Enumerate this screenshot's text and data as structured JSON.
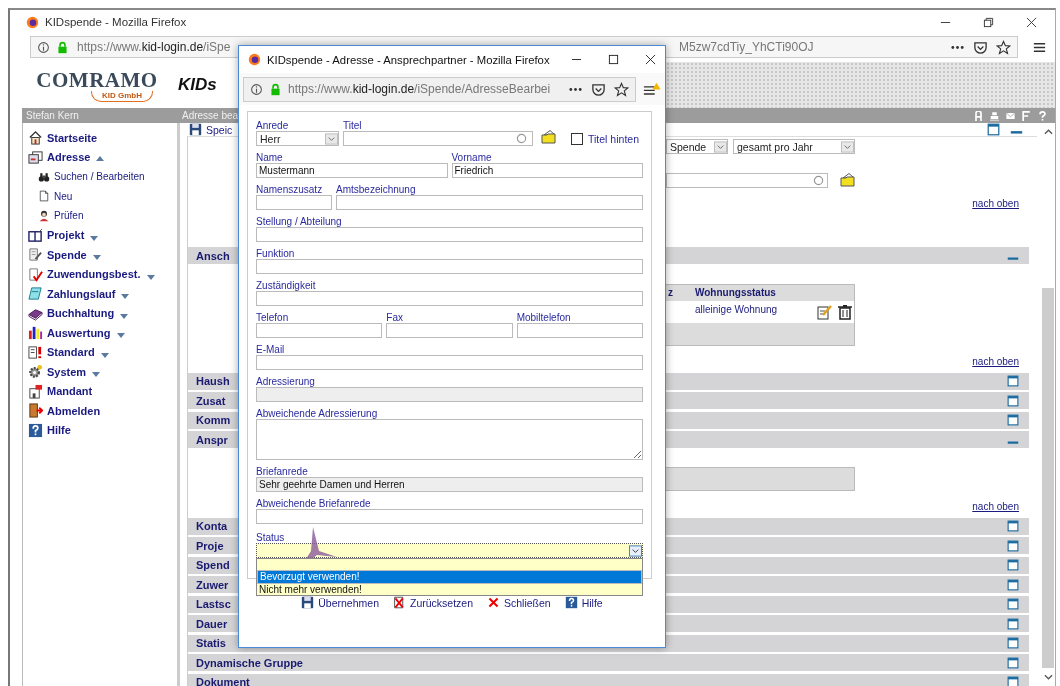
{
  "window": {
    "title": "KIDspende - Mozilla Firefox",
    "url": {
      "scheme": "https://www.",
      "domain": "kid-login.de",
      "path": "/iSpe"
    },
    "url_end": "M5zw7cdTiy_YhCTi90OJ"
  },
  "header": {
    "logo": "COMRAMO",
    "logo_badge": "KID GmbH",
    "brand": "KIDs"
  },
  "user_bar": {
    "user": "Stefan Kern",
    "page_title": "Adresse bea"
  },
  "sidebar": {
    "items": [
      {
        "label": "Startseite",
        "kind": "link"
      },
      {
        "label": "Adresse",
        "kind": "group",
        "expanded": true,
        "children": [
          {
            "label": "Suchen / Bearbeiten"
          },
          {
            "label": "Neu"
          },
          {
            "label": "Prüfen"
          }
        ]
      },
      {
        "label": "Projekt",
        "kind": "group",
        "expanded": false
      },
      {
        "label": "Spende",
        "kind": "group",
        "expanded": false
      },
      {
        "label": "Zuwendungsbest.",
        "kind": "group",
        "expanded": false
      },
      {
        "label": "Zahlungslauf",
        "kind": "group",
        "expanded": false
      },
      {
        "label": "Buchhaltung",
        "kind": "group",
        "expanded": false
      },
      {
        "label": "Auswertung",
        "kind": "group",
        "expanded": false
      },
      {
        "label": "Standard",
        "kind": "group",
        "expanded": false
      },
      {
        "label": "System",
        "kind": "group",
        "expanded": false
      },
      {
        "label": "Mandant",
        "kind": "link"
      },
      {
        "label": "Abmelden",
        "kind": "link"
      },
      {
        "label": "Hilfe",
        "kind": "link"
      }
    ]
  },
  "content": {
    "toolbar_button": "Speic",
    "filters": [
      "Spende",
      "gesamt pro Jahr"
    ],
    "top_link": "nach oben",
    "sections": [
      {
        "title": "Ansch",
        "expanded": true,
        "table": {
          "columns": [
            "z",
            "Wohnungsstatus"
          ],
          "rows": [
            {
              "wohnungsstatus": "alleinige Wohnung"
            }
          ]
        },
        "link": "nach oben"
      },
      {
        "title": "Haush",
        "expanded": false
      },
      {
        "title": "Zusat",
        "expanded": false
      },
      {
        "title": "Komm",
        "expanded": false
      },
      {
        "title": "Anspr",
        "expanded": true,
        "link": "nach oben"
      },
      {
        "title": "Konta",
        "expanded": false
      },
      {
        "title": "Proje",
        "expanded": false
      },
      {
        "title": "Spend",
        "expanded": false
      },
      {
        "title": "Zuwer",
        "expanded": false
      },
      {
        "title": "Lastsc",
        "expanded": false
      },
      {
        "title": "Dauer",
        "expanded": false
      },
      {
        "title": "Statis",
        "expanded": false
      },
      {
        "title": "Dynamische Gruppe",
        "expanded": false
      },
      {
        "title": "Dokument",
        "expanded": false
      }
    ]
  },
  "popup": {
    "title": "KIDspende - Adresse - Ansprechpartner - Mozilla Firefox",
    "url": {
      "scheme": "https://www.",
      "domain": "kid-login.de",
      "path": "/iSpende/AdresseBearbei"
    },
    "form": {
      "anrede": {
        "label": "Anrede",
        "value": "Herr"
      },
      "titel": {
        "label": "Titel"
      },
      "titel_hinten": {
        "label": "Titel hinten",
        "checked": false
      },
      "rows": [
        {
          "fields": [
            {
              "label": "Name",
              "kind": "text",
              "value": "Mustermann"
            },
            {
              "label": "Vorname",
              "kind": "text",
              "value": "Friedrich"
            }
          ]
        },
        {
          "fields": [
            {
              "label": "Namenszusatz",
              "kind": "text"
            },
            {
              "label": "Amtsbezeichnung",
              "kind": "text"
            }
          ]
        },
        {
          "fields": [
            {
              "label": "Stellung / Abteilung",
              "kind": "text"
            }
          ]
        },
        {
          "fields": [
            {
              "label": "Funktion",
              "kind": "text"
            }
          ]
        },
        {
          "fields": [
            {
              "label": "Zuständigkeit",
              "kind": "text"
            }
          ]
        },
        {
          "fields": [
            {
              "label": "Telefon",
              "kind": "text"
            },
            {
              "label": "Fax",
              "kind": "text"
            },
            {
              "label": "Mobiltelefon",
              "kind": "text"
            }
          ]
        },
        {
          "fields": [
            {
              "label": "E-Mail",
              "kind": "text"
            }
          ]
        },
        {
          "fields": [
            {
              "label": "Adressierung",
              "kind": "readonly"
            }
          ]
        },
        {
          "fields": [
            {
              "label": "Abweichende Adressierung",
              "kind": "textarea"
            }
          ]
        },
        {
          "fields": [
            {
              "label": "Briefanrede",
              "kind": "readonly",
              "value": "Sehr geehrte Damen und Herren"
            }
          ]
        },
        {
          "fields": [
            {
              "label": "Abweichende Briefanrede",
              "kind": "text"
            }
          ]
        }
      ],
      "status": {
        "label": "Status",
        "open": true,
        "options": [
          {
            "label": "Bevorzugt verwenden!",
            "selected": true
          },
          {
            "label": "Nicht mehr verwenden!",
            "selected": false
          }
        ]
      }
    },
    "buttons": [
      {
        "label": "Übernehmen"
      },
      {
        "label": "Zurücksetzen"
      },
      {
        "label": "Schließen"
      },
      {
        "label": "Hilfe"
      }
    ]
  }
}
